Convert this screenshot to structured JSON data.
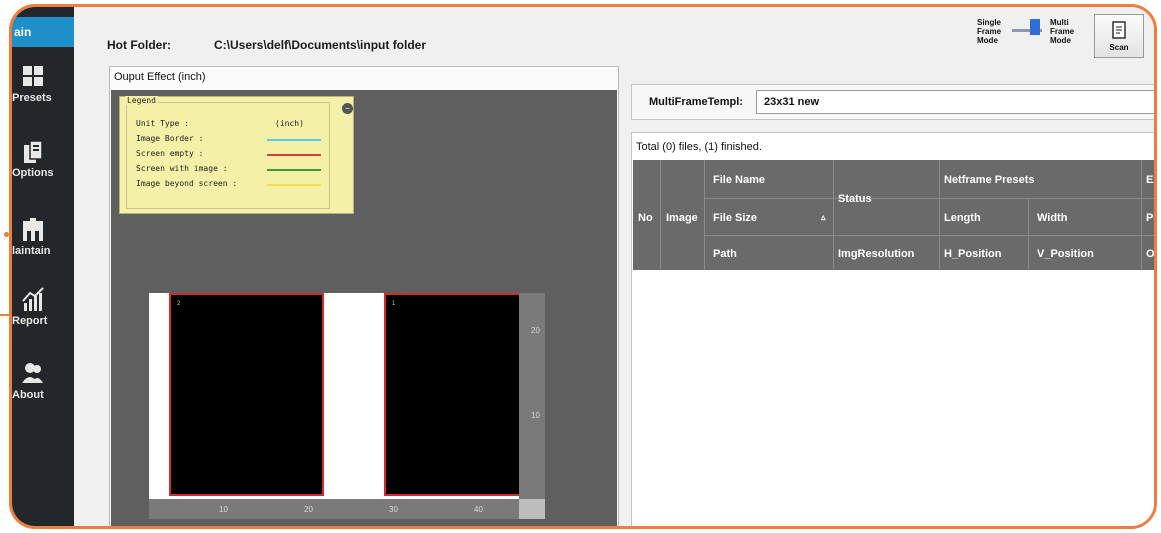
{
  "sidebar": {
    "items": [
      {
        "label": "Main",
        "icon": "home-icon"
      },
      {
        "label": "Presets",
        "icon": "presets-icon"
      },
      {
        "label": "Options",
        "icon": "options-icon"
      },
      {
        "label": "Maintain",
        "icon": "maintain-icon"
      },
      {
        "label": "Report",
        "icon": "report-icon"
      },
      {
        "label": "About",
        "icon": "about-icon"
      }
    ],
    "visible_labels": [
      "ain",
      "Presets",
      "Options",
      "laintain",
      "Report",
      "About"
    ]
  },
  "header": {
    "hot_folder_label": "Hot Folder:",
    "hot_folder_value": "C:\\Users\\delf\\Documents\\input folder",
    "single_mode": [
      "Single",
      "Frame",
      "Mode"
    ],
    "multi_mode": [
      "Multi",
      "Frame",
      "Mode"
    ],
    "scan_label": "Scan",
    "mode_selected": "multi"
  },
  "output": {
    "title": "Ouput Effect   (inch)",
    "legend": {
      "title": "Legend",
      "unit_label": "Unit Type :",
      "unit_value": "(inch)",
      "rows": [
        {
          "label": "Image Border :",
          "color": "#5cc8e6"
        },
        {
          "label": "Screen empty :",
          "color": "#d63a3a"
        },
        {
          "label": "Screen with image :",
          "color": "#3c9a3c"
        },
        {
          "label": "Image beyond screen :",
          "color": "#f0e04a"
        }
      ]
    },
    "images": [
      {
        "num": "2"
      },
      {
        "num": "1"
      }
    ],
    "ruler_right": [
      "20",
      "10"
    ],
    "ruler_bottom": [
      "10",
      "20",
      "30",
      "40"
    ]
  },
  "multiframe": {
    "label": "MultiFrameTempl:",
    "value": "23x31 new"
  },
  "list": {
    "summary": "Total (0) files, (1) finished.",
    "headers": {
      "no": "No",
      "image": "Image",
      "file_name": "File Name",
      "file_size": "File Size",
      "path": "Path",
      "status": "Status",
      "img_resolution": "ImgResolution",
      "netframe_presets": "Netframe Presets",
      "length": "Length",
      "width": "Width",
      "h_position": "H_Position",
      "v_position": "V_Position",
      "ex": "Ex",
      "pe": "Pe",
      "ou": "Ou"
    }
  },
  "colors": {
    "accent": "#f07d3c",
    "sidebar_bg": "#23262b",
    "sidebar_active": "#1f8fc9",
    "grid_header": "#6a6a6a"
  }
}
